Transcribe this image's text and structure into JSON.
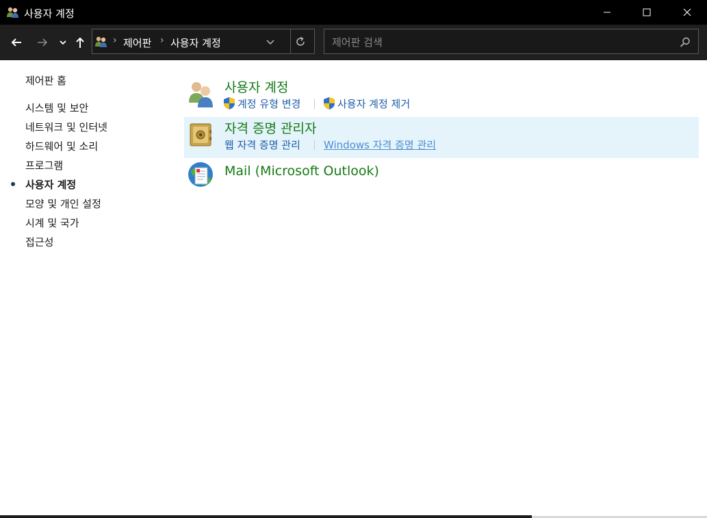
{
  "window": {
    "title": "사용자 계정",
    "icon": "users-icon",
    "controls": {
      "minimize": "minimize-icon",
      "maximize": "maximize-icon",
      "close": "close-icon"
    }
  },
  "nav": {
    "back": "back-arrow-icon",
    "forward": "forward-arrow-icon",
    "recent": "chevron-down-icon",
    "up": "up-arrow-icon"
  },
  "address": {
    "breadcrumbs": [
      "제어판",
      "사용자 계정"
    ],
    "refresh": "refresh-icon"
  },
  "search": {
    "placeholder": "제어판 검색",
    "value": ""
  },
  "sidebar": {
    "items": [
      {
        "label": "제어판 홈",
        "active": false
      },
      {
        "label": "시스템 및 보안",
        "active": false
      },
      {
        "label": "네트워크 및 인터넷",
        "active": false
      },
      {
        "label": "하드웨어 및 소리",
        "active": false
      },
      {
        "label": "프로그램",
        "active": false
      },
      {
        "label": "사용자 계정",
        "active": true
      },
      {
        "label": "모양 및 개인 설정",
        "active": false
      },
      {
        "label": "시계 및 국가",
        "active": false
      },
      {
        "label": "접근성",
        "active": false
      }
    ]
  },
  "categories": [
    {
      "title": "사용자 계정",
      "icon": "user-accounts-icon",
      "tasks": [
        {
          "label": "계정 유형 변경",
          "shield": true
        },
        {
          "label": "사용자 계정 제거",
          "shield": true
        }
      ]
    },
    {
      "title": "자격 증명 관리자",
      "icon": "credential-manager-icon",
      "hover": true,
      "tasks": [
        {
          "label": "웹 자격 증명 관리",
          "shield": false
        },
        {
          "label": "Windows 자격 증명 관리",
          "shield": false,
          "hovered": true
        }
      ]
    },
    {
      "title": "Mail (Microsoft Outlook)",
      "icon": "mail-icon",
      "tasks": []
    }
  ],
  "colors": {
    "titlebar": "#000000",
    "navbar": "#1f1f1f",
    "category_title": "#147a14",
    "task_link": "#1d5ea8",
    "hover_bg": "#e5f3fb"
  }
}
